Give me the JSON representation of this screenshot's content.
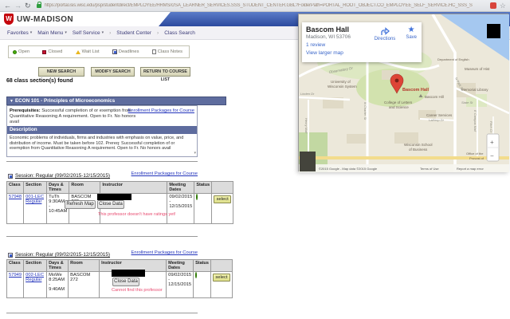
{
  "browser": {
    "url": "https://portal.isis.wisc.edu/psp/studentdirect/EMPLOYEE/HRMS/c/SA_LEARNER_SERVICES.SSS_STUDENT_CENTER.GBL?FolderPath=PORTAL_ROOT_OBJECT.CO_EMPLOYEE_SELF_SERVICE.HC_SSS_S",
    "back": "←",
    "forward": "→",
    "reload": "↻",
    "bookmark_star": "☆"
  },
  "header": {
    "brand": "UW-MADISON",
    "crest_letter": "W"
  },
  "breadcrumb": {
    "items": [
      "Favorites",
      "Main Menu",
      "Self Service",
      "Student Center",
      "Class Search"
    ],
    "caret": "▾",
    "separator": "›"
  },
  "legend": {
    "items": [
      {
        "label": "Open"
      },
      {
        "label": "Closed"
      },
      {
        "label": "Wait List"
      },
      {
        "label": "Deadlines"
      },
      {
        "label": "Class Notes"
      }
    ]
  },
  "toolbar": {
    "buttons": [
      "NEW SEARCH",
      "MODIFY SEARCH",
      "RETURN TO COURSE LIST"
    ]
  },
  "results": {
    "count_text": "68 class section(s) found",
    "course": {
      "collapse_icon": "▼",
      "title": "ECON 101 - Principles of Microeconomics",
      "prereq_label": "Prerequisites:",
      "prereq_text": "Successful completion of or exemption from Quantitative Reasoning A requirement. Open to Fr. No honors avail",
      "packages_link": "Enrollment Packages for Course",
      "description_label": "Description",
      "description_text": "Economic problems of individuals, firms and industries with emphasis on value, price, and distribution of income. Must be taken before 102. Prereq: Successful completion of or exemption from Quantitative Reasoning A requirement. Open to Fr. No honors avail",
      "scroll_hint": "▾"
    },
    "columns": [
      "Class",
      "Section",
      "Days & Times",
      "Room",
      "Instructor",
      "Meeting Dates",
      "Status",
      ""
    ],
    "sessions": [
      {
        "packages_link": "Enrollment Packages for Course",
        "session_text": "Session: Regular (09/02/2015-12/15/2015)",
        "row": {
          "class_nbr": "57948",
          "section_code": "001-LEC",
          "section_type": "Regular",
          "days_times": "TuTh 9:30AM - 10:45AM",
          "room": "BASCOM 272",
          "meeting_dates": "09/02/2015 - 12/15/2015",
          "select_label": "select",
          "refresh_btn": "Refresh Map",
          "close_btn": "Close Data",
          "note": "This professor doesn't have ratings yet!"
        }
      },
      {
        "packages_link": "Enrollment Packages for Course",
        "session_text": "Session: Regular (09/02/2015-12/15/2015)",
        "row": {
          "class_nbr": "57949",
          "section_code": "002-LEC",
          "section_type": "Regular",
          "days_times": "MoWe 8:25AM - 9:40AM",
          "room": "BASCOM 272",
          "meeting_dates": "09/02/2015 - 12/15/2015",
          "select_label": "select",
          "close_btn": "Close Data",
          "note": "Cannot find this professor"
        }
      }
    ]
  },
  "map": {
    "card": {
      "title": "Bascom Hall",
      "address": "Madison, WI 53706",
      "review_link": "1 review",
      "larger_link": "View larger map",
      "directions_label": "Directions",
      "save_label": "Save",
      "save_star": "★"
    },
    "marker_label": "Bascom Hall",
    "zoom_in": "+",
    "zoom_out": "−",
    "attribution": "©2015 Google - Map data ©2015 Google",
    "terms": "Terms of Use",
    "report": "Report a map error",
    "labels": [
      {
        "text": "Observatory Dr"
      },
      {
        "text": "University of"
      },
      {
        "text": "Wisconsin System"
      },
      {
        "text": "College of Letters"
      },
      {
        "text": "and Science"
      },
      {
        "text": "Bascom Hill"
      },
      {
        "text": "Memorial Library"
      },
      {
        "text": "Museum of Hist"
      },
      {
        "text": "Department of English"
      },
      {
        "text": "N Park St"
      },
      {
        "text": "N Charter St"
      },
      {
        "text": "Linden Dr"
      },
      {
        "text": "Henry Mall"
      },
      {
        "text": "Career Services"
      },
      {
        "text": "Lathrop Dr"
      },
      {
        "text": "State St"
      },
      {
        "text": "E Campus Mall"
      },
      {
        "text": "Fitch Ct"
      },
      {
        "text": "Wisconsin School"
      },
      {
        "text": "of Business"
      },
      {
        "text": "Office of the"
      },
      {
        "text": "Provost of"
      }
    ],
    "colors": {
      "water": "#a5c8f0",
      "land": "#ece8da",
      "park": "#d2e2ae",
      "marker": "#dd4437"
    }
  },
  "colors": {
    "brand_red": "#c5050c",
    "nav_blue": "#2c4a9e",
    "header_navy": "#5e6c9e",
    "link_blue": "#2233bb",
    "status_open_green": "#4aae0c",
    "closed_red": "#c51230",
    "waitlist_yellow": "#e9b71f",
    "note_pink": "#e84a6f",
    "select_button": "#e7e79c"
  }
}
